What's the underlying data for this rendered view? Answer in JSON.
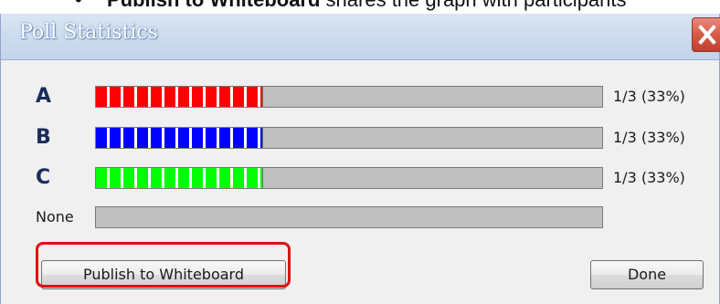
{
  "doc_text": {
    "bullet": "•",
    "bold": "Publish to Whiteboard",
    "rest": " shares the graph with participants"
  },
  "window": {
    "title": "Poll Statistics"
  },
  "results": [
    {
      "label": "A",
      "count": "1/3 (33%)",
      "fraction": 0.33,
      "color": "#ff0000"
    },
    {
      "label": "B",
      "count": "1/3 (33%)",
      "color": "#0000ff",
      "fraction": 0.33
    },
    {
      "label": "C",
      "count": "1/3 (33%)",
      "color": "#00ff00",
      "fraction": 0.33
    },
    {
      "label": "None",
      "count": "",
      "color": "#c0c0c0",
      "fraction": 0
    }
  ],
  "buttons": {
    "publish": "Publish to Whiteboard",
    "done": "Done"
  },
  "colors": {
    "highlight": "#e01010"
  }
}
